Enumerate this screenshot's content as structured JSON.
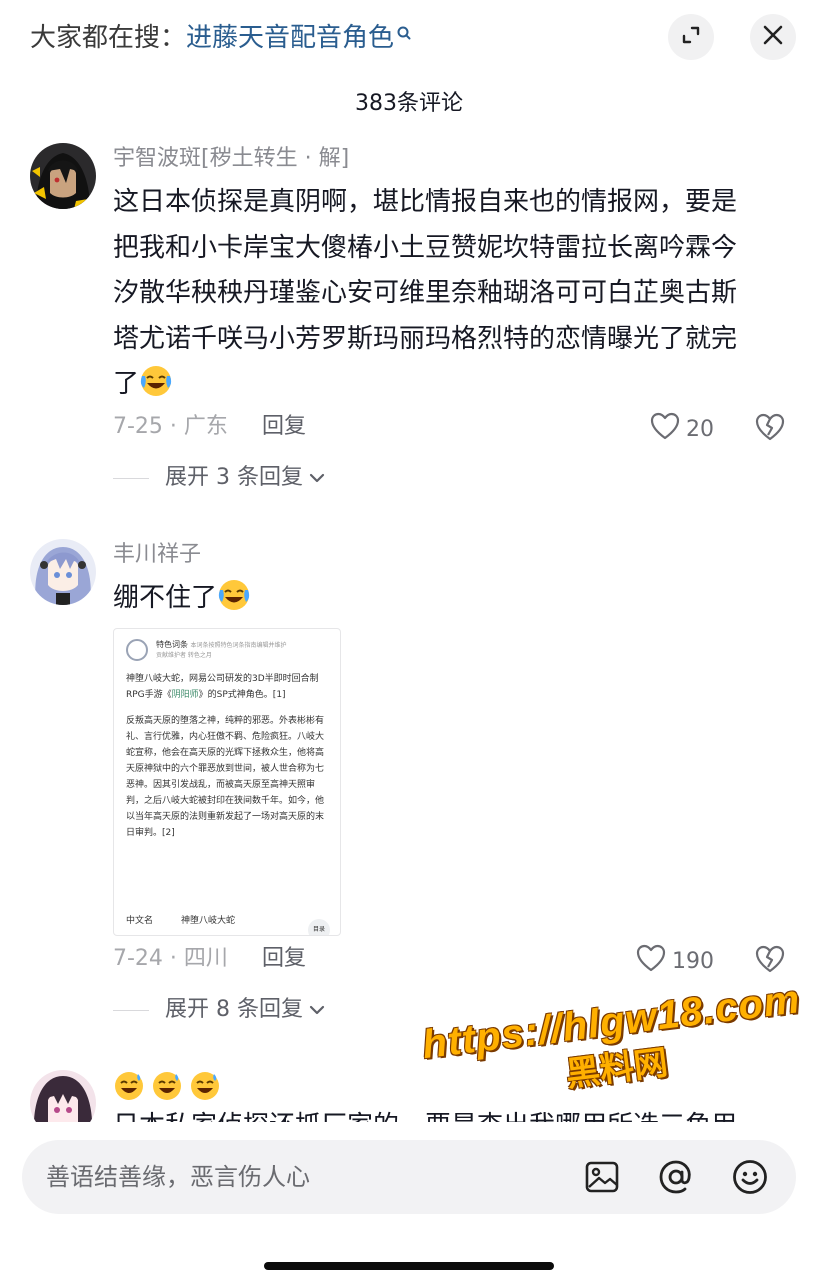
{
  "top_bar": {
    "hot_prefix": "大家都在搜：",
    "hot_query": "进藤天音配音角色",
    "collapse_icon": "collapse-arrows-icon",
    "close_icon": "close-icon"
  },
  "comment_count": "383条评论",
  "comments": [
    {
      "user": "宇智波斑[秽土转生 · 解]",
      "text_lines": [
        "这日本侦探是真阴啊，堪比情报自来也的情报网，要是",
        "把我和小卡岸宝大傻椿小土豆赞妮坎特雷拉长离吟霖今",
        "汐散华秧秧丹瑾鉴心安可维里奈釉瑚洛可可白芷奥古斯",
        "塔尤诺千咲马小芳罗斯玛丽玛格烈特的恋情曝光了就完",
        "了"
      ],
      "emoji": "tears-of-joy-emoji",
      "date_loc": "7-25 · 广东",
      "reply_label": "回复",
      "likes": "20",
      "expand_label": "展开 3 条回复"
    },
    {
      "user": "丰川祥子",
      "text": "绷不住了",
      "emoji": "tears-of-joy-emoji",
      "date_loc": "7-24 · 四川",
      "reply_label": "回复",
      "likes": "190",
      "expand_label": "展开 8 条回复",
      "image": {
        "head_title": "特色词条",
        "head_note": "本词条按照特色词条指南编辑并维护",
        "head_note2": "贡献维护者 转色之月",
        "para1_a": "神堕八岐大蛇，网易公司研发的3D半即时回合制RPG手游《",
        "para1_link": "阴阳师",
        "para1_b": "》的SP式神角色。[1]",
        "para2": "反叛高天原的堕落之神，纯粹的邪恶。外表彬彬有礼、言行优雅，内心狂傲不羁、危险疯狂。八岐大蛇宣称，他会在高天原的光辉下拯救众生，他将高天原神狱中的六个罪恶放到世间，被人世合称为七恶神。因其引发战乱，而被高天原至高神天照审判，之后八岐大蛇被封印在狭间数千年。如今，他以当年高天原的法则重新发起了一场对高天原的末日审判。[2]",
        "info_key": "中文名",
        "info_val": "神堕八岐大蛇",
        "toc": "目录"
      }
    },
    {
      "emojis": [
        "sweat-smile-emoji",
        "sweat-smile-emoji",
        "sweat-smile-emoji"
      ],
      "text": "日本私家侦探还抓厂家的，要是查出我哪用所选三角用"
    }
  ],
  "watermark": {
    "url": "https://hlgw18.com",
    "name": "黑料网"
  },
  "input": {
    "placeholder": "善语结善缘，恶言伤人心",
    "icons": [
      "image-icon",
      "at-icon",
      "emoji-face-icon"
    ]
  },
  "colors": {
    "link": "#2a5d8f",
    "meta": "#a6a7ab",
    "username": "#8a8b91",
    "watermark": "#ffb000"
  }
}
